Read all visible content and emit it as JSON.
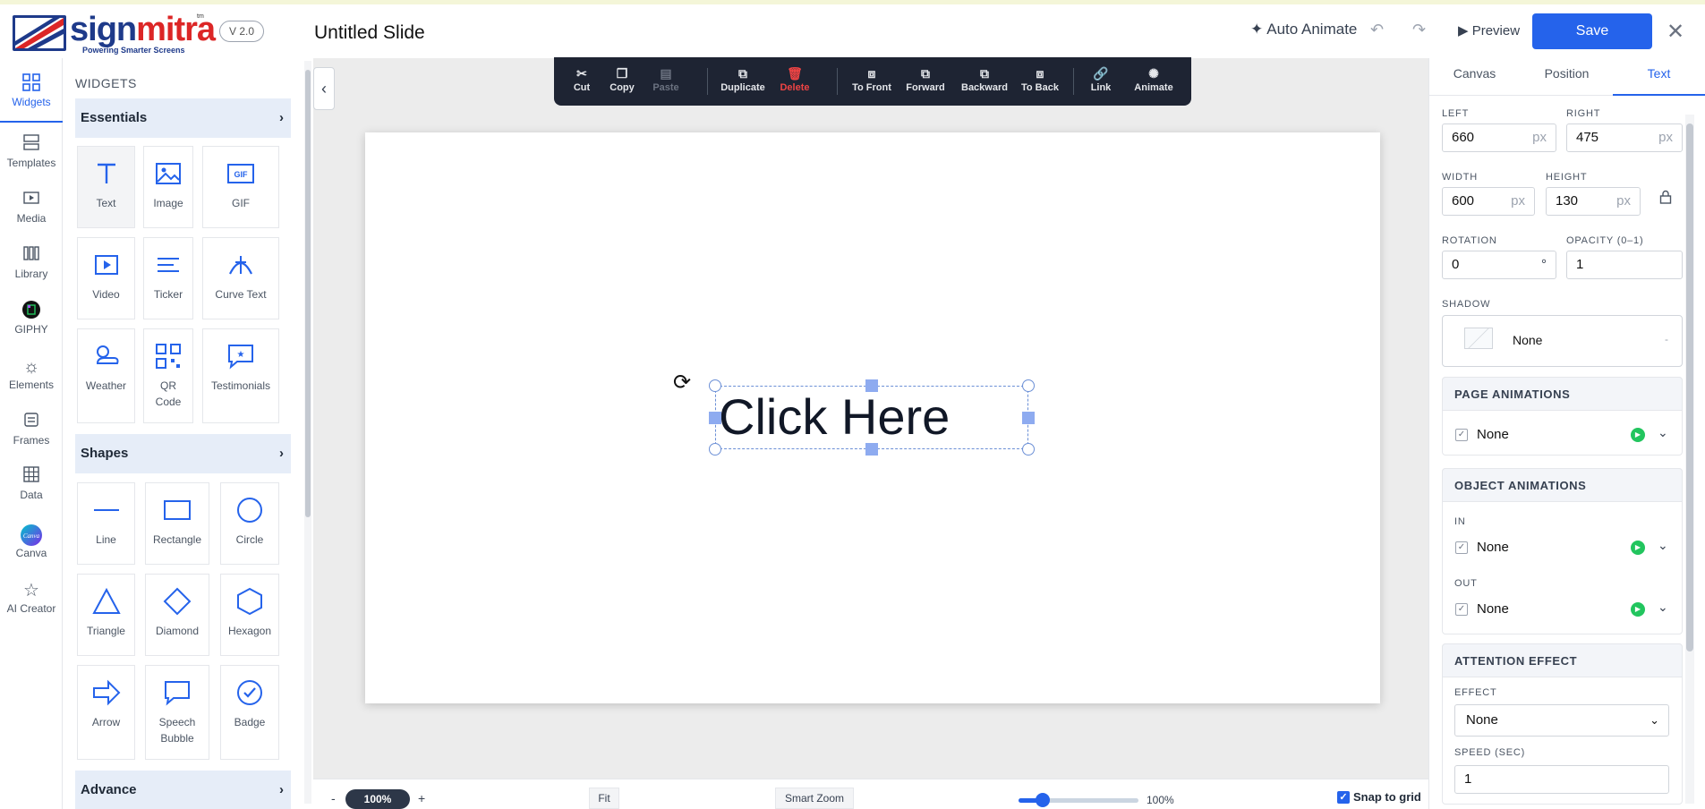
{
  "header": {
    "logo_sign": "sign",
    "logo_mitra": "mitra",
    "logo_tm": "tm",
    "logo_tagline": "Powering Smarter Screens",
    "version": "V 2.0",
    "slide_title": "Untitled Slide",
    "auto_animate": "Auto Animate",
    "preview": "Preview",
    "save": "Save"
  },
  "rail": {
    "items": [
      {
        "label": "Widgets",
        "icon": "grid-icon"
      },
      {
        "label": "Templates",
        "icon": "templates-icon"
      },
      {
        "label": "Media",
        "icon": "media-icon"
      },
      {
        "label": "Library",
        "icon": "library-icon"
      },
      {
        "label": "GIPHY",
        "icon": "giphy-icon"
      },
      {
        "label": "Elements",
        "icon": "elements-icon"
      },
      {
        "label": "Frames",
        "icon": "frames-icon"
      },
      {
        "label": "Data",
        "icon": "data-icon"
      },
      {
        "label": "Canva",
        "icon": "canva-icon"
      },
      {
        "label": "AI Creator",
        "icon": "star-icon"
      }
    ],
    "active": "Widgets"
  },
  "widgets": {
    "title": "WIDGETS",
    "sections": {
      "essentials": "Essentials",
      "shapes": "Shapes",
      "advance": "Advance"
    },
    "essentials": [
      "Text",
      "Image",
      "GIF",
      "Video",
      "Ticker",
      "Curve Text",
      "Weather",
      "QR Code",
      "Testimonials"
    ],
    "shapes": [
      "Line",
      "Rectangle",
      "Circle",
      "Triangle",
      "Diamond",
      "Hexagon",
      "Arrow",
      "Speech Bubble",
      "Badge"
    ],
    "gif_icon_text": "GIF"
  },
  "toolbar": {
    "items": [
      "Cut",
      "Copy",
      "Paste",
      "Duplicate",
      "Delete",
      "To Front",
      "Forward",
      "Backward",
      "To Back",
      "Link",
      "Animate"
    ],
    "disabled": [
      "Paste"
    ],
    "danger": [
      "Delete"
    ]
  },
  "canvas": {
    "text": "Click Here"
  },
  "bottom": {
    "zoom_minus": "-",
    "zoom_value": "100%",
    "zoom_plus": "+",
    "fit": "Fit",
    "smart_zoom": "Smart Zoom",
    "slider_value": "100%",
    "slider_fraction": 0.2,
    "snap": "Snap to grid",
    "snap_checked": true
  },
  "props": {
    "tabs": [
      "Canvas",
      "Position",
      "Text"
    ],
    "active_tab": "Text",
    "left_label": "LEFT",
    "left": "660",
    "right_label": "RIGHT",
    "right": "475",
    "width_label": "WIDTH",
    "width": "600",
    "height_label": "HEIGHT",
    "height": "130",
    "unit": "px",
    "rotation_label": "ROTATION",
    "rotation": "0",
    "rotation_unit": "°",
    "opacity_label": "OPACITY (0–1)",
    "opacity": "1",
    "shadow_label": "SHADOW",
    "shadow": "None",
    "shadow_caret": "-",
    "page_animations": "PAGE ANIMATIONS",
    "page_anim_value": "None",
    "object_animations": "OBJECT ANIMATIONS",
    "in_label": "IN",
    "in_value": "None",
    "out_label": "OUT",
    "out_value": "None",
    "attention_effect": "ATTENTION EFFECT",
    "effect_label": "EFFECT",
    "effect_value": "None",
    "speed_label": "SPEED (SEC)",
    "speed_value": "1"
  },
  "colors": {
    "accent": "#2563eb",
    "brand_blue": "#1e3a8a",
    "brand_red": "#dc2626",
    "toolbar_bg": "#1e2433",
    "play_green": "#22c55e"
  }
}
